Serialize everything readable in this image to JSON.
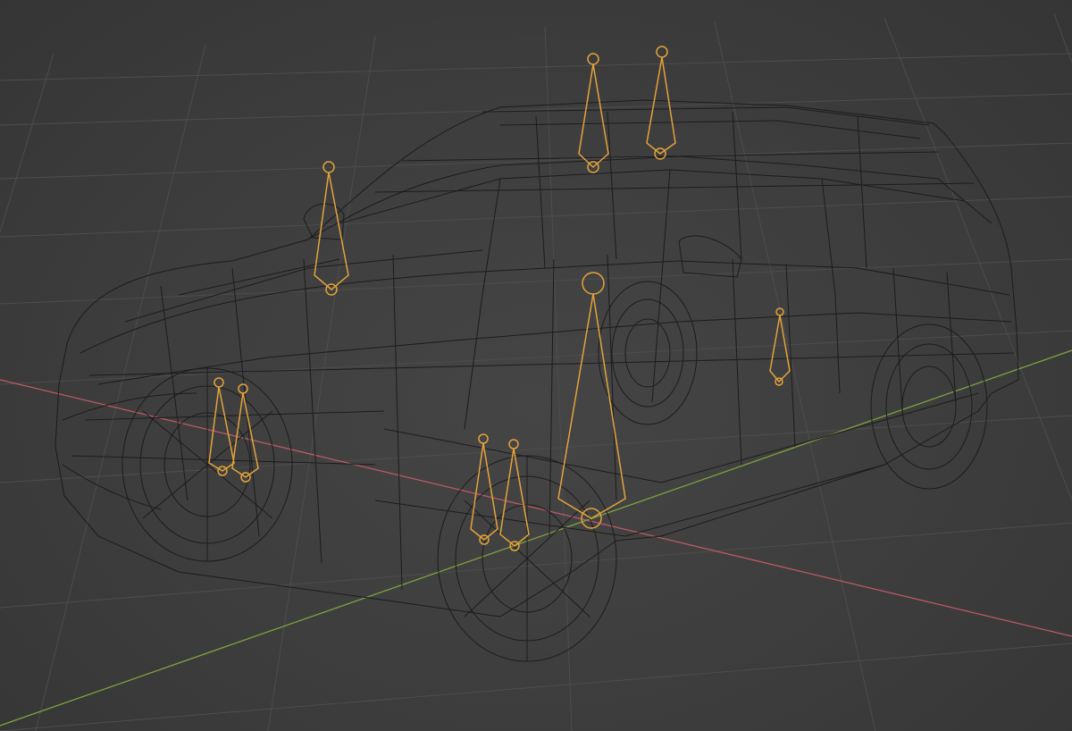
{
  "app": "3D viewport",
  "view": {
    "shading": "wireframe",
    "grid": true,
    "visible_text": []
  },
  "colors": {
    "background": "#3d3d3d",
    "grid": "#4d4d4d",
    "wire": "#1c1c1c",
    "x_axis": "#c25a68",
    "y_axis": "#7ea03e",
    "bone": "#e3a33a"
  },
  "scene": {
    "object": "car-mesh-wireframe",
    "armature": "car-rig",
    "bones": [
      {
        "id": "mirror-bone"
      },
      {
        "id": "roof-bone-front"
      },
      {
        "id": "roof-bone-rear"
      },
      {
        "id": "front-wheel-bone-1"
      },
      {
        "id": "front-wheel-bone-2"
      },
      {
        "id": "mid-wheel-bone-1"
      },
      {
        "id": "mid-wheel-bone-2"
      },
      {
        "id": "body-bone"
      },
      {
        "id": "rear-bone"
      }
    ]
  }
}
